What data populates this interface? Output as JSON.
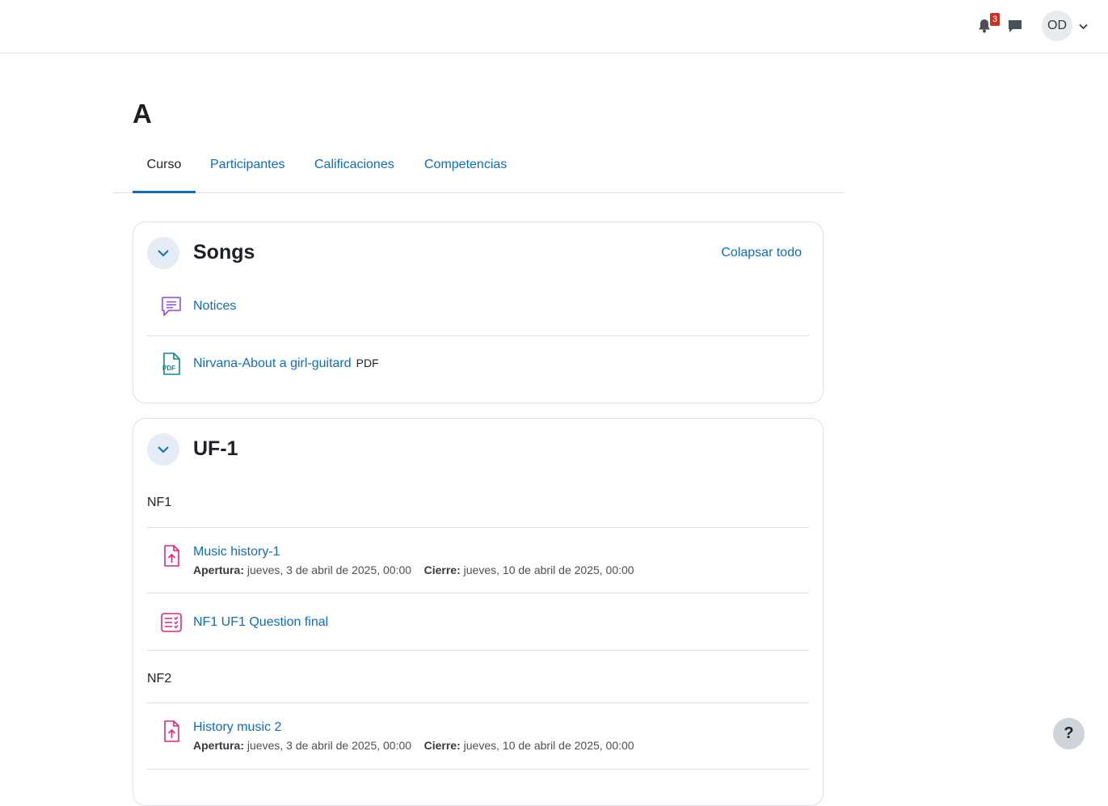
{
  "navbar": {
    "notifications_count": "3",
    "user_initials": "OD"
  },
  "course": {
    "title": "A",
    "tabs": [
      "Curso",
      "Participantes",
      "Calificaciones",
      "Competencias"
    ]
  },
  "sections": [
    {
      "title": "Songs",
      "collapse_all_label": "Colapsar todo",
      "activities": [
        {
          "name": "Notices",
          "icon": "forum-icon"
        },
        {
          "name": "Nirvana-About a girl-guitard",
          "tag": "PDF",
          "icon": "pdf-file-icon"
        }
      ]
    },
    {
      "title": "UF-1",
      "subheadings": [
        "NF1",
        "NF2"
      ],
      "activities": [
        {
          "name": "Music history-1",
          "icon": "assignment-upload-icon",
          "open_label": "Apertura:",
          "open_value": "jueves, 3 de abril de 2025, 00:00",
          "close_label": "Cierre:",
          "close_value": "jueves, 10 de abril de 2025, 00:00"
        },
        {
          "name": "NF1 UF1 Question final",
          "icon": "quiz-icon"
        },
        {
          "name": "History music 2",
          "icon": "assignment-upload-icon",
          "open_label": "Apertura:",
          "open_value": "jueves, 3 de abril de 2025, 00:00",
          "close_label": "Cierre:",
          "close_value": "jueves, 10 de abril de 2025, 00:00"
        }
      ]
    }
  ],
  "help_label": "?",
  "colors": {
    "link": "#0f6cbf",
    "forum_icon": "#8f4ce0",
    "pdf_icon": "#0d8a8a",
    "assignment_icon": "#e0267f",
    "badge": "#ca3120"
  }
}
